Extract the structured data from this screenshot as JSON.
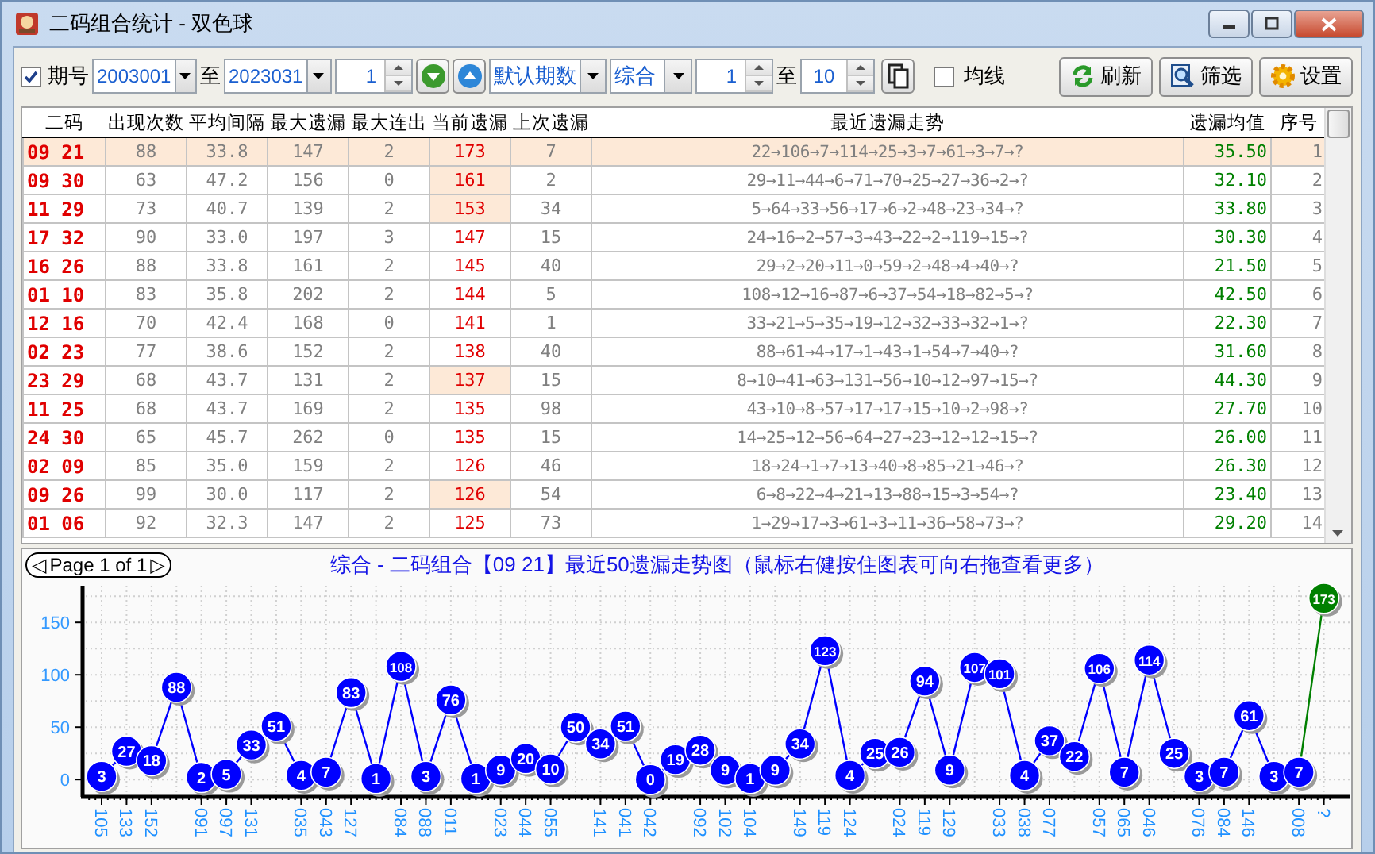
{
  "window": {
    "title": "二码组合统计 - 双色球"
  },
  "toolbar": {
    "period": {
      "label": "期号",
      "checked": true
    },
    "from": "2003001",
    "to_label": "至",
    "to": "2023031",
    "step": "1",
    "range_mode": "默认期数",
    "category": "综合",
    "min": "1",
    "max_label": "至",
    "max": "10",
    "average_line": {
      "label": "均线",
      "checked": false
    },
    "buttons": [
      {
        "kind": "refresh",
        "label": "刷新"
      },
      {
        "kind": "filter",
        "label": "筛选"
      },
      {
        "kind": "settings",
        "label": "设置"
      }
    ]
  },
  "table": {
    "columns": [
      "二码",
      "出现次数",
      "平均间隔",
      "最大遗漏",
      "最大连出",
      "当前遗漏",
      "上次遗漏",
      "最近遗漏走势",
      "遗漏均值",
      "序号"
    ],
    "rows": [
      {
        "pair": "09 21",
        "count": "88",
        "avg": "33.8",
        "max_miss": "147",
        "max_run": "2",
        "current": "173",
        "last": "7",
        "trend": "22→106→7→114→25→3→7→61→3→7→?",
        "mean": "35.50",
        "seq": "1",
        "selected": true,
        "current_highlight": false
      },
      {
        "pair": "09 30",
        "count": "63",
        "avg": "47.2",
        "max_miss": "156",
        "max_run": "0",
        "current": "161",
        "last": "2",
        "trend": "29→11→44→6→71→70→25→27→36→2→?",
        "mean": "32.10",
        "seq": "2",
        "selected": false,
        "current_highlight": true
      },
      {
        "pair": "11 29",
        "count": "73",
        "avg": "40.7",
        "max_miss": "139",
        "max_run": "2",
        "current": "153",
        "last": "34",
        "trend": "5→64→33→56→17→6→2→48→23→34→?",
        "mean": "33.80",
        "seq": "3",
        "selected": false,
        "current_highlight": true
      },
      {
        "pair": "17 32",
        "count": "90",
        "avg": "33.0",
        "max_miss": "197",
        "max_run": "3",
        "current": "147",
        "last": "15",
        "trend": "24→16→2→57→3→43→22→2→119→15→?",
        "mean": "30.30",
        "seq": "4",
        "selected": false,
        "current_highlight": false
      },
      {
        "pair": "16 26",
        "count": "88",
        "avg": "33.8",
        "max_miss": "161",
        "max_run": "2",
        "current": "145",
        "last": "40",
        "trend": "29→2→20→11→0→59→2→48→4→40→?",
        "mean": "21.50",
        "seq": "5",
        "selected": false,
        "current_highlight": false
      },
      {
        "pair": "01 10",
        "count": "83",
        "avg": "35.8",
        "max_miss": "202",
        "max_run": "2",
        "current": "144",
        "last": "5",
        "trend": "108→12→16→87→6→37→54→18→82→5→?",
        "mean": "42.50",
        "seq": "6",
        "selected": false,
        "current_highlight": false
      },
      {
        "pair": "12 16",
        "count": "70",
        "avg": "42.4",
        "max_miss": "168",
        "max_run": "0",
        "current": "141",
        "last": "1",
        "trend": "33→21→5→35→19→12→32→33→32→1→?",
        "mean": "22.30",
        "seq": "7",
        "selected": false,
        "current_highlight": false
      },
      {
        "pair": "02 23",
        "count": "77",
        "avg": "38.6",
        "max_miss": "152",
        "max_run": "2",
        "current": "138",
        "last": "40",
        "trend": "88→61→4→17→1→43→1→54→7→40→?",
        "mean": "31.60",
        "seq": "8",
        "selected": false,
        "current_highlight": false
      },
      {
        "pair": "23 29",
        "count": "68",
        "avg": "43.7",
        "max_miss": "131",
        "max_run": "2",
        "current": "137",
        "last": "15",
        "trend": "8→10→41→63→131→56→10→12→97→15→?",
        "mean": "44.30",
        "seq": "9",
        "selected": false,
        "current_highlight": true
      },
      {
        "pair": "11 25",
        "count": "68",
        "avg": "43.7",
        "max_miss": "169",
        "max_run": "2",
        "current": "135",
        "last": "98",
        "trend": "43→10→8→57→17→17→15→10→2→98→?",
        "mean": "27.70",
        "seq": "10",
        "selected": false,
        "current_highlight": false
      },
      {
        "pair": "24 30",
        "count": "65",
        "avg": "45.7",
        "max_miss": "262",
        "max_run": "0",
        "current": "135",
        "last": "15",
        "trend": "14→25→12→56→64→27→23→12→12→15→?",
        "mean": "26.00",
        "seq": "11",
        "selected": false,
        "current_highlight": false
      },
      {
        "pair": "02 09",
        "count": "85",
        "avg": "35.0",
        "max_miss": "159",
        "max_run": "2",
        "current": "126",
        "last": "46",
        "trend": "18→24→1→7→13→40→8→85→21→46→?",
        "mean": "26.30",
        "seq": "12",
        "selected": false,
        "current_highlight": false
      },
      {
        "pair": "09 26",
        "count": "99",
        "avg": "30.0",
        "max_miss": "117",
        "max_run": "2",
        "current": "126",
        "last": "54",
        "trend": "6→8→22→4→21→13→88→15→3→54→?",
        "mean": "23.40",
        "seq": "13",
        "selected": false,
        "current_highlight": true
      },
      {
        "pair": "01 06",
        "count": "92",
        "avg": "32.3",
        "max_miss": "147",
        "max_run": "2",
        "current": "125",
        "last": "73",
        "trend": "1→29→17→3→61→3→11→36→58→73→?",
        "mean": "29.20",
        "seq": "14",
        "selected": false,
        "current_highlight": false
      }
    ]
  },
  "chart": {
    "prev": "◁",
    "page": "Page 1 of 1",
    "next": "▷",
    "chart_data": {
      "type": "line",
      "title": "综合 - 二码组合【09 21】最近50遗漏走势图（鼠标右健按住图表可向右拖查看更多）",
      "ylim": [
        -15,
        185
      ],
      "yticks": [
        0,
        50,
        100,
        150
      ],
      "data_labels": true,
      "grid": true,
      "categories": [
        "105",
        "133",
        "152",
        null,
        "091",
        "097",
        "131",
        null,
        "035",
        "043",
        "127",
        null,
        "084",
        "088",
        "011",
        null,
        "023",
        "044",
        "055",
        null,
        "141",
        "041",
        "042",
        null,
        "092",
        "102",
        "104",
        null,
        "149",
        "119",
        "124",
        null,
        "024",
        "119",
        "129",
        null,
        "033",
        "038",
        "077",
        null,
        "057",
        "065",
        "046",
        null,
        "076",
        "084",
        "146",
        null,
        "008",
        "?"
      ],
      "series": [
        {
          "color": "#0000ff",
          "marker": "circle",
          "values": [
            3,
            27,
            18,
            88,
            2,
            5,
            33,
            51,
            4,
            7,
            83,
            1,
            108,
            3,
            76,
            1,
            9,
            20,
            10,
            50,
            34,
            51,
            0,
            19,
            28,
            9,
            1,
            9,
            34,
            123,
            4,
            25,
            26,
            94,
            9,
            107,
            101,
            4,
            37,
            22,
            106,
            7,
            114,
            25,
            3,
            7,
            61,
            3,
            7,
            null
          ]
        },
        {
          "color": "#008000",
          "marker": "circle",
          "values": [
            null,
            null,
            null,
            null,
            null,
            null,
            null,
            null,
            null,
            null,
            null,
            null,
            null,
            null,
            null,
            null,
            null,
            null,
            null,
            null,
            null,
            null,
            null,
            null,
            null,
            null,
            null,
            null,
            null,
            null,
            null,
            null,
            null,
            null,
            null,
            null,
            null,
            null,
            null,
            null,
            null,
            null,
            null,
            null,
            null,
            null,
            null,
            null,
            null,
            173
          ]
        }
      ]
    }
  }
}
